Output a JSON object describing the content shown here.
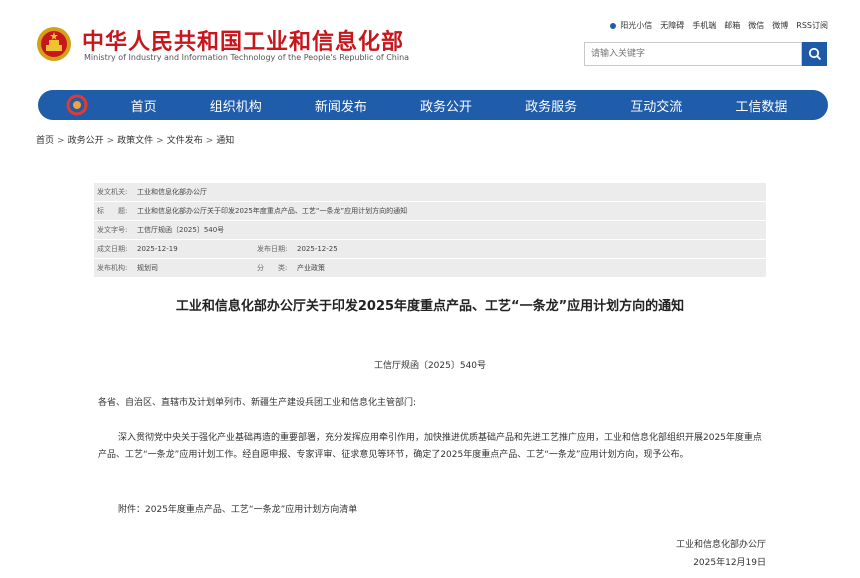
{
  "header": {
    "site_title": "中华人民共和国工业和信息化部",
    "site_subtitle": "Ministry of Industry and Information Technology of the People's Republic of China",
    "top_links": [
      "阳光小信",
      "无障碍",
      "手机端",
      "邮箱",
      "微信",
      "微博",
      "RSS订阅"
    ],
    "search_placeholder": "请输入关键字",
    "colors": {
      "brand_red": "#c8161d",
      "nav_blue": "#1f5ca9"
    }
  },
  "nav": {
    "items": [
      "首页",
      "组织机构",
      "新闻发布",
      "政务公开",
      "政务服务",
      "互动交流",
      "工信数据"
    ]
  },
  "breadcrumb": [
    "首页",
    "政务公开",
    "政策文件",
    "文件发布",
    "通知"
  ],
  "breadcrumb_sep": ">",
  "meta": {
    "issuer_label": "发文机关:",
    "issuer": "工业和信息化部办公厅",
    "title_label": "标　　题:",
    "title": "工业和信息化部办公厅关于印发2025年度重点产品、工艺“一条龙”应用计划方向的通知",
    "doc_no_label": "发文字号:",
    "doc_no": "工信厅规函〔2025〕540号",
    "created_label": "成文日期:",
    "created": "2025-12-19",
    "published_label": "发布日期:",
    "published": "2025-12-25",
    "org_label": "发布机构:",
    "org": "规划司",
    "category_label": "分　　类:",
    "category": "产业政策"
  },
  "document": {
    "title": "工业和信息化部办公厅关于印发2025年度重点产品、工艺“一条龙”应用计划方向的通知",
    "number": "工信厅规函〔2025〕540号",
    "salutation": "各省、自治区、直辖市及计划单列市、新疆生产建设兵团工业和信息化主管部门:",
    "body": "深入贯彻党中央关于强化产业基础再造的重要部署，充分发挥应用牵引作用，加快推进优质基础产品和先进工艺推广应用，工业和信息化部组织开展2025年度重点产品、工艺“一条龙”应用计划工作。经自愿申报、专家评审、征求意见等环节，确定了2025年度重点产品、工艺“一条龙”应用计划方向，现予公布。",
    "attachment": "附件：2025年度重点产品、工艺“一条龙”应用计划方向清单",
    "signature_org": "工业和信息化部办公厅",
    "signature_date": "2025年12月19日"
  }
}
